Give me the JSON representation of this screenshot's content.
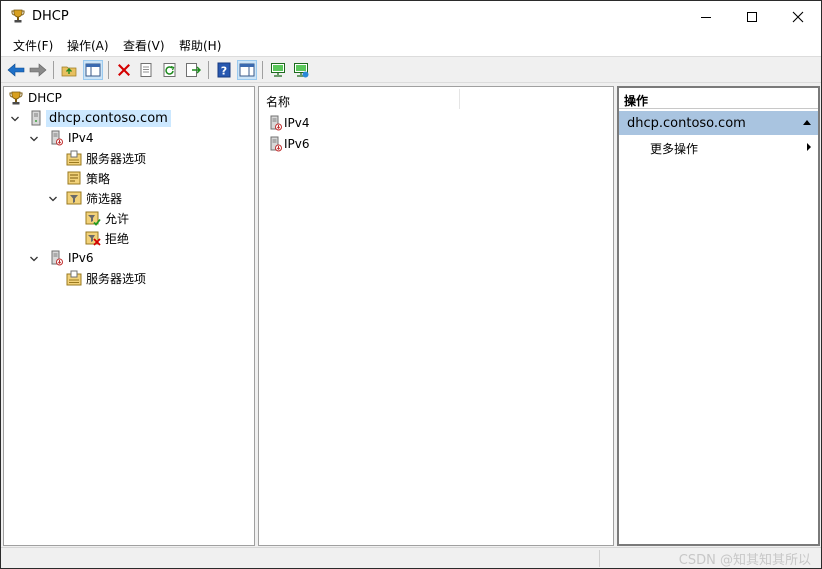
{
  "window": {
    "title": "DHCP",
    "icon": "dhcp-trophy-icon",
    "caption_buttons": [
      "minimize-icon",
      "maximize-icon",
      "close-icon"
    ]
  },
  "menu": [
    "文件(F)",
    "操作(A)",
    "查看(V)",
    "帮助(H)"
  ],
  "toolbar": {
    "icons": [
      "back-arrow-icon",
      "forward-arrow-icon",
      "up-folder-icon",
      "show-hide-tree-icon",
      "delete-icon",
      "properties-icon",
      "refresh-icon",
      "export-list-icon",
      "help-icon",
      "show-action-pane-icon",
      "server-icon",
      "authorize-server-icon"
    ]
  },
  "tree": {
    "root": "DHCP",
    "server": "dhcp.contoso.com",
    "ipv4": "IPv4",
    "ipv4_server_options": "服务器选项",
    "policies": "策略",
    "filters": "筛选器",
    "allow": "允许",
    "deny": "拒绝",
    "ipv6": "IPv6",
    "ipv6_server_options": "服务器选项"
  },
  "list": {
    "column_name": "名称",
    "rows": [
      "IPv4",
      "IPv6"
    ]
  },
  "actions": {
    "title": "操作",
    "section": "dhcp.contoso.com",
    "more": "更多操作"
  },
  "status": {
    "watermark": "CSDN @知其知其所以"
  },
  "colors": {
    "selection": "#cce8ff",
    "action_section": "#a9c4e0",
    "back_arrow": "#1e70c8",
    "delete": "#d40000"
  }
}
